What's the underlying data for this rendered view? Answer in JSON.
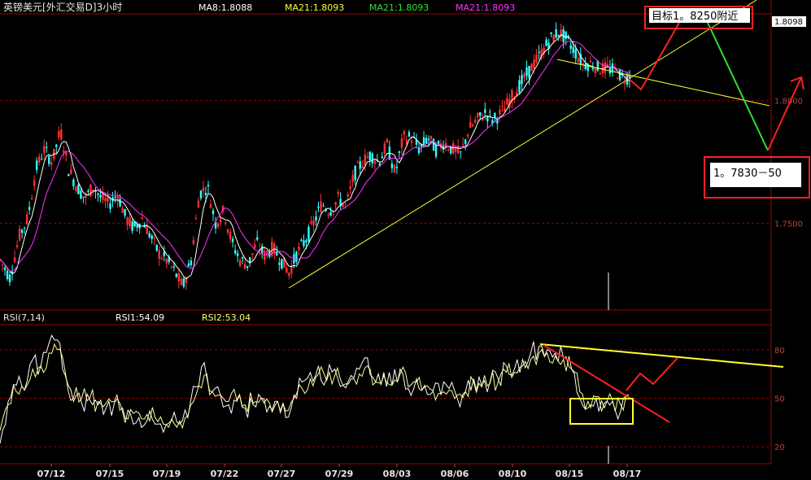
{
  "header": {
    "title": "英镑美元[外汇交易D]3小时",
    "ma8": "MA8:1.8088",
    "ma21a": "MA21:1.8093",
    "ma21b": "MA21:1.8093",
    "ma21c": "MA21:1.8093"
  },
  "annotations": {
    "target_high": "目标1。8250附近",
    "target_low": "1。7830－50",
    "price_tag": "1.8098"
  },
  "rsi_header": {
    "name": "RSI(7,14)",
    "rsi1": "RSI1:54.09",
    "rsi2": "RSI2:53.04"
  },
  "colors": {
    "background": "#000000",
    "up_candle": "#ff3030",
    "down_candle": "#33ffff",
    "ma8": "#ffffff",
    "ma21": "#ff33ff",
    "trendline": "#ffff33",
    "projection_up": "#ff2020",
    "projection_down": "#33dd33",
    "grid": "#990000",
    "tick_text": "#c04040"
  },
  "chart_data": [
    {
      "type": "candlestick",
      "x_ticks": [
        "07/12",
        "07/15",
        "07/19",
        "07/22",
        "07/27",
        "07/29",
        "08/03",
        "08/06",
        "08/10",
        "08/15",
        "08/17"
      ],
      "y_ticks": [
        1.75,
        1.8
      ],
      "y_tick_labels": [
        "1.7500",
        "1.8000"
      ],
      "ylim": [
        1.715,
        1.835
      ],
      "close_path": [
        [
          0,
          1.735
        ],
        [
          12,
          1.728
        ],
        [
          24,
          1.745
        ],
        [
          34,
          1.752
        ],
        [
          44,
          1.772
        ],
        [
          54,
          1.78
        ],
        [
          64,
          1.775
        ],
        [
          74,
          1.788
        ],
        [
          84,
          1.772
        ],
        [
          94,
          1.765
        ],
        [
          104,
          1.76
        ],
        [
          114,
          1.765
        ],
        [
          124,
          1.76
        ],
        [
          134,
          1.758
        ],
        [
          144,
          1.762
        ],
        [
          154,
          1.752
        ],
        [
          164,
          1.748
        ],
        [
          174,
          1.752
        ],
        [
          184,
          1.745
        ],
        [
          194,
          1.738
        ],
        [
          204,
          1.735
        ],
        [
          214,
          1.73
        ],
        [
          224,
          1.724
        ],
        [
          234,
          1.735
        ],
        [
          244,
          1.762
        ],
        [
          254,
          1.765
        ],
        [
          264,
          1.75
        ],
        [
          274,
          1.755
        ],
        [
          284,
          1.742
        ],
        [
          294,
          1.735
        ],
        [
          304,
          1.733
        ],
        [
          314,
          1.742
        ],
        [
          324,
          1.737
        ],
        [
          334,
          1.74
        ],
        [
          344,
          1.735
        ],
        [
          354,
          1.73
        ],
        [
          364,
          1.738
        ],
        [
          374,
          1.743
        ],
        [
          384,
          1.75
        ],
        [
          394,
          1.758
        ],
        [
          404,
          1.755
        ],
        [
          414,
          1.76
        ],
        [
          424,
          1.757
        ],
        [
          434,
          1.77
        ],
        [
          444,
          1.775
        ],
        [
          454,
          1.778
        ],
        [
          464,
          1.775
        ],
        [
          474,
          1.782
        ],
        [
          484,
          1.77
        ],
        [
          494,
          1.785
        ],
        [
          504,
          1.785
        ],
        [
          514,
          1.78
        ],
        [
          524,
          1.785
        ],
        [
          534,
          1.78
        ],
        [
          544,
          1.783
        ],
        [
          554,
          1.78
        ],
        [
          564,
          1.778
        ],
        [
          574,
          1.788
        ],
        [
          584,
          1.792
        ],
        [
          594,
          1.795
        ],
        [
          604,
          1.792
        ],
        [
          614,
          1.795
        ],
        [
          624,
          1.8
        ],
        [
          634,
          1.805
        ],
        [
          644,
          1.81
        ],
        [
          654,
          1.815
        ],
        [
          664,
          1.82
        ],
        [
          674,
          1.825
        ],
        [
          684,
          1.828
        ],
        [
          694,
          1.825
        ],
        [
          704,
          1.82
        ],
        [
          714,
          1.815
        ],
        [
          724,
          1.815
        ],
        [
          734,
          1.813
        ],
        [
          744,
          1.813
        ],
        [
          754,
          1.812
        ],
        [
          764,
          1.809
        ],
        [
          772,
          1.81
        ]
      ]
    },
    {
      "type": "line",
      "title": "RSI(7,14)",
      "y_ticks": [
        20,
        50,
        80
      ],
      "ylim": [
        10,
        95
      ],
      "series": [
        {
          "name": "RSI1",
          "values": [
            [
              0,
              22
            ],
            [
              10,
              48
            ],
            [
              20,
              58
            ],
            [
              30,
              55
            ],
            [
              40,
              74
            ],
            [
              50,
              70
            ],
            [
              60,
              84
            ],
            [
              70,
              86
            ],
            [
              80,
              64
            ],
            [
              90,
              48
            ],
            [
              100,
              47
            ],
            [
              110,
              49
            ],
            [
              120,
              46
            ],
            [
              130,
              44
            ],
            [
              140,
              47
            ],
            [
              150,
              42
            ],
            [
              160,
              40
            ],
            [
              170,
              38
            ],
            [
              180,
              36
            ],
            [
              190,
              34
            ],
            [
              200,
              29
            ],
            [
              210,
              36
            ],
            [
              220,
              34
            ],
            [
              230,
              38
            ],
            [
              240,
              57
            ],
            [
              250,
              72
            ],
            [
              260,
              54
            ],
            [
              270,
              52
            ],
            [
              280,
              46
            ],
            [
              290,
              48
            ],
            [
              300,
              44
            ],
            [
              310,
              46
            ],
            [
              320,
              50
            ],
            [
              330,
              45
            ],
            [
              340,
              48
            ],
            [
              350,
              38
            ],
            [
              360,
              52
            ],
            [
              370,
              60
            ],
            [
              380,
              66
            ],
            [
              390,
              70
            ],
            [
              400,
              62
            ],
            [
              410,
              68
            ],
            [
              420,
              58
            ],
            [
              430,
              64
            ],
            [
              440,
              68
            ],
            [
              450,
              75
            ],
            [
              460,
              60
            ],
            [
              470,
              66
            ],
            [
              480,
              58
            ],
            [
              490,
              68
            ],
            [
              500,
              56
            ],
            [
              510,
              62
            ],
            [
              520,
              58
            ],
            [
              530,
              54
            ],
            [
              540,
              52
            ],
            [
              550,
              56
            ],
            [
              560,
              50
            ],
            [
              570,
              54
            ],
            [
              580,
              62
            ],
            [
              590,
              58
            ],
            [
              600,
              60
            ],
            [
              610,
              62
            ],
            [
              620,
              70
            ],
            [
              630,
              68
            ],
            [
              640,
              74
            ],
            [
              650,
              78
            ],
            [
              660,
              82
            ],
            [
              670,
              80
            ],
            [
              680,
              78
            ],
            [
              690,
              75
            ],
            [
              700,
              68
            ],
            [
              710,
              50
            ],
            [
              720,
              44
            ],
            [
              730,
              50
            ],
            [
              740,
              44
            ],
            [
              750,
              48
            ],
            [
              760,
              42
            ],
            [
              770,
              52
            ]
          ]
        },
        {
          "name": "RSI2",
          "values": [
            [
              0,
              30
            ],
            [
              10,
              46
            ],
            [
              20,
              54
            ],
            [
              30,
              55
            ],
            [
              40,
              68
            ],
            [
              50,
              70
            ],
            [
              60,
              78
            ],
            [
              70,
              80
            ],
            [
              80,
              66
            ],
            [
              90,
              50
            ],
            [
              100,
              50
            ],
            [
              110,
              50
            ],
            [
              120,
              48
            ],
            [
              130,
              47
            ],
            [
              140,
              48
            ],
            [
              150,
              44
            ],
            [
              160,
              43
            ],
            [
              170,
              41
            ],
            [
              180,
              40
            ],
            [
              190,
              38
            ],
            [
              200,
              34
            ],
            [
              210,
              37
            ],
            [
              220,
              36
            ],
            [
              230,
              39
            ],
            [
              240,
              52
            ],
            [
              250,
              64
            ],
            [
              260,
              54
            ],
            [
              270,
              52
            ],
            [
              280,
              48
            ],
            [
              290,
              49
            ],
            [
              300,
              46
            ],
            [
              310,
              47
            ],
            [
              320,
              50
            ],
            [
              330,
              47
            ],
            [
              340,
              48
            ],
            [
              350,
              42
            ],
            [
              360,
              50
            ],
            [
              370,
              56
            ],
            [
              380,
              62
            ],
            [
              390,
              65
            ],
            [
              400,
              61
            ],
            [
              410,
              64
            ],
            [
              420,
              58
            ],
            [
              430,
              62
            ],
            [
              440,
              65
            ],
            [
              450,
              70
            ],
            [
              460,
              60
            ],
            [
              470,
              64
            ],
            [
              480,
              58
            ],
            [
              490,
              65
            ],
            [
              500,
              57
            ],
            [
              510,
              60
            ],
            [
              520,
              57
            ],
            [
              530,
              55
            ],
            [
              540,
              53
            ],
            [
              550,
              55
            ],
            [
              560,
              52
            ],
            [
              570,
              54
            ],
            [
              580,
              60
            ],
            [
              590,
              57
            ],
            [
              600,
              59
            ],
            [
              610,
              60
            ],
            [
              620,
              66
            ],
            [
              630,
              66
            ],
            [
              640,
              70
            ],
            [
              650,
              74
            ],
            [
              660,
              78
            ],
            [
              670,
              78
            ],
            [
              680,
              76
            ],
            [
              690,
              74
            ],
            [
              700,
              68
            ],
            [
              710,
              54
            ],
            [
              720,
              48
            ],
            [
              730,
              51
            ],
            [
              740,
              47
            ],
            [
              750,
              49
            ],
            [
              760,
              46
            ],
            [
              770,
              52
            ]
          ]
        }
      ]
    }
  ]
}
